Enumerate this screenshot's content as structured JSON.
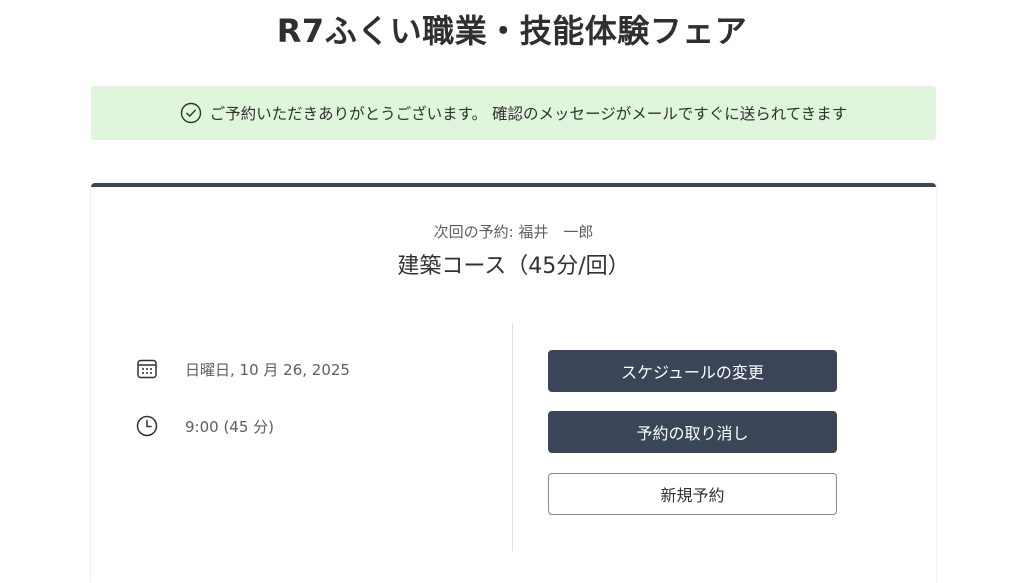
{
  "header": {
    "title": "R7ふくい職業・技能体験フェア"
  },
  "banner": {
    "icon": "check-circle-icon",
    "message": "ご予約いただきありがとうございます。 確認のメッセージがメールですぐに送られてきます",
    "color": "#dff6dd"
  },
  "booking": {
    "next_label": "次回の予約: 福井　一郎",
    "course": "建築コース（45分/回）",
    "date_icon": "calendar-icon",
    "date": "日曜日, 10 月 26, 2025",
    "time_icon": "clock-icon",
    "time": "9:00 (45 分)",
    "accent_color": "#3b4558"
  },
  "actions": {
    "reschedule_label": "スケジュールの変更",
    "cancel_label": "予約の取り消し",
    "new_label": "新規予約"
  }
}
